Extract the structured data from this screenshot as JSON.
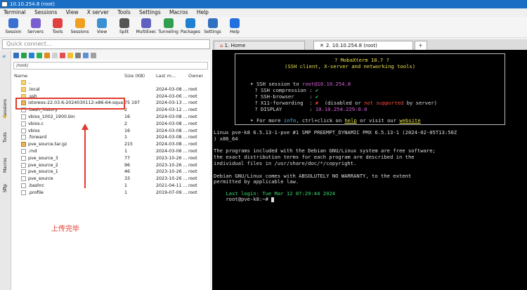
{
  "window": {
    "title": "10.10.254.8 (root)"
  },
  "menu": [
    "Terminal",
    "Sessions",
    "View",
    "X server",
    "Tools",
    "Settings",
    "Macros",
    "Help"
  ],
  "toolbar": [
    {
      "label": "Session",
      "icon": "session-icon",
      "color": "#3b6fd0"
    },
    {
      "label": "Servers",
      "icon": "servers-icon",
      "color": "#7a5fd0"
    },
    {
      "label": "Tools",
      "icon": "tools-icon",
      "color": "#e04040"
    },
    {
      "label": "Sessions",
      "icon": "sessions-icon",
      "color": "#f0a020"
    },
    {
      "label": "View",
      "icon": "view-icon",
      "color": "#3a90d0"
    },
    {
      "label": "Split",
      "icon": "split-icon",
      "color": "#555555"
    },
    {
      "label": "MultiExec",
      "icon": "multiexec-icon",
      "color": "#6060c0"
    },
    {
      "label": "Tunneling",
      "icon": "tunneling-icon",
      "color": "#30a050"
    },
    {
      "label": "Packages",
      "icon": "packages-icon",
      "color": "#2080d0"
    },
    {
      "label": "Settings",
      "icon": "settings-icon",
      "color": "#3070c0"
    },
    {
      "label": "Help",
      "icon": "help-icon",
      "color": "#2070e0"
    }
  ],
  "quick_connect": {
    "placeholder": "Quick connect..."
  },
  "side_tabs": [
    "Sessions",
    "Tools",
    "Macros",
    "Sftp"
  ],
  "sftp": {
    "path": "/root/",
    "columns": {
      "name": "Name",
      "size": "Size (KB)",
      "modified": "Last m...",
      "owner": "Owner"
    },
    "files": [
      {
        "name": "..",
        "size": "",
        "modified": "",
        "owner": "",
        "type": "folder"
      },
      {
        "name": ".local",
        "size": "",
        "modified": "2024-03-08 ...",
        "owner": "root",
        "type": "folder"
      },
      {
        "name": ".ssh",
        "size": "",
        "modified": "2024-03-06 ...",
        "owner": "root",
        "type": "folder"
      },
      {
        "name": "istoreos-22.03.6-2024030112-x86-64-squas...",
        "size": "75 197",
        "modified": "2024-03-13 ...",
        "owner": "root",
        "type": "arch"
      },
      {
        "name": ".bash_history",
        "size": "2",
        "modified": "2024-03-12 ...",
        "owner": "root",
        "type": "file"
      },
      {
        "name": "vbios_1002_1900.bin",
        "size": "16",
        "modified": "2024-03-08 ...",
        "owner": "root",
        "type": "file"
      },
      {
        "name": "vbios.c",
        "size": "2",
        "modified": "2024-03-08 ...",
        "owner": "root",
        "type": "file"
      },
      {
        "name": "vbios",
        "size": "16",
        "modified": "2024-03-08 ...",
        "owner": "root",
        "type": "file"
      },
      {
        "name": ".forward",
        "size": "1",
        "modified": "2024-03-08 ...",
        "owner": "root",
        "type": "file"
      },
      {
        "name": "pve_source.tar.gz",
        "size": "215",
        "modified": "2024-03-08 ...",
        "owner": "root",
        "type": "arch"
      },
      {
        "name": ".rnd",
        "size": "1",
        "modified": "2024-03-06 ...",
        "owner": "root",
        "type": "file"
      },
      {
        "name": "pve_source_3",
        "size": "77",
        "modified": "2023-10-26 ...",
        "owner": "root",
        "type": "file"
      },
      {
        "name": "pve_source_2",
        "size": "96",
        "modified": "2023-10-26 ...",
        "owner": "root",
        "type": "file"
      },
      {
        "name": "pve_source_1",
        "size": "46",
        "modified": "2023-10-26 ...",
        "owner": "root",
        "type": "file"
      },
      {
        "name": "pve_source",
        "size": "33",
        "modified": "2023-10-26 ...",
        "owner": "root",
        "type": "file"
      },
      {
        "name": ".bashrc",
        "size": "1",
        "modified": "2021-04-11 ...",
        "owner": "root",
        "type": "file"
      },
      {
        "name": ".profile",
        "size": "1",
        "modified": "2019-07-09 ...",
        "owner": "root",
        "type": "file"
      }
    ]
  },
  "annotation": {
    "text": "上传完毕",
    "color": "#e03a2e"
  },
  "tabs": [
    {
      "label": "1. Home"
    },
    {
      "label": "2. 10.10.254.8 (root)"
    }
  ],
  "terminal": {
    "banner_title": "? MobaXterm 10.7 ?",
    "banner_sub": "(SSH client, X-server and networking tools)",
    "ssh_prefix": "➤ SSH session to ",
    "ssh_user": "root",
    "ssh_host": "@10.10.254.8",
    "compression": "? SSH compression : ",
    "browser": "? SSH-browser     : ",
    "x11": "? X11-forwarding  : ",
    "x11_disabled": "(disabled",
    "x11_or": " or ",
    "x11_not": "not supported",
    "x11_by": " by server)",
    "display_lbl": "? DISPLAY         : ",
    "display_val": "10.10.254.229:0.0",
    "more_a": "➤ For more ",
    "more_info": "info",
    "more_b": ", ctrl+click on ",
    "more_help": "help",
    "more_c": " or visit our ",
    "more_site": "website",
    "check": "✔",
    "cross": "✘",
    "lines": [
      "Linux pve-k8 6.5.13-1-pve #1 SMP PREEMPT_DYNAMIC PMX 6.5.13-1 (2024-02-05T13:50Z",
      ") x86_64",
      "",
      "The programs included with the Debian GNU/Linux system are free software;",
      "the exact distribution terms for each program are described in the",
      "individual files in /usr/share/doc/*/copyright.",
      "",
      "Debian GNU/Linux comes with ABSOLUTELY NO WARRANTY, to the extent",
      "permitted by applicable law."
    ],
    "last_login_lbl": "Last login:",
    "last_login_val": " Tue Mar 12 07:29:44 2024",
    "prompt": "root@pve-k8:~# "
  }
}
